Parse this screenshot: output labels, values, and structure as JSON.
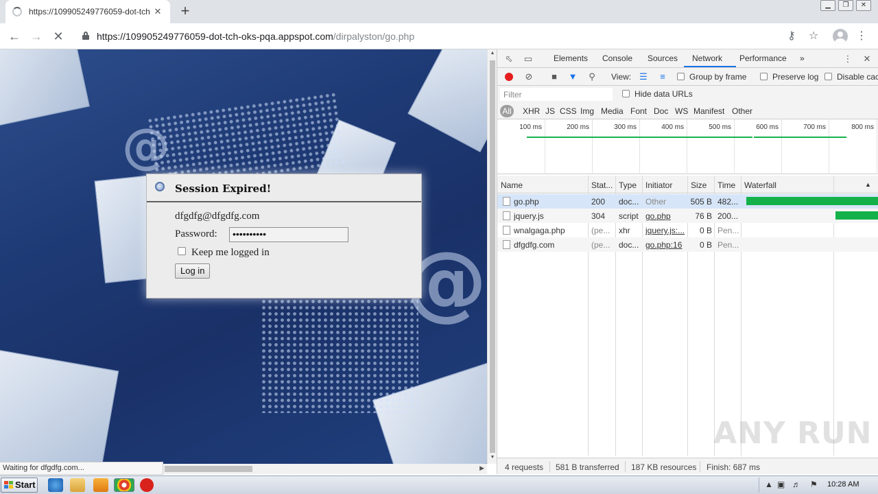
{
  "browser": {
    "tab_title": "https://109905249776059-dot-tch-oks",
    "tab_close": "✕",
    "new_tab": "+",
    "url_host": "https://109905249776059-dot-tch-oks-pqa.appspot.com",
    "url_path": "/dirpalyston/go.php",
    "window_buttons": [
      "▁",
      "❐",
      "✕"
    ]
  },
  "page": {
    "dialog_title": "Session Expired!",
    "email": "dfgdfg@dfgdfg.com",
    "password_label": "Password:",
    "password_value": "••••••••••",
    "keep_logged_in": "Keep me logged in",
    "login_button": "Log in",
    "status_bubble": "Waiting for dfgdfg.com..."
  },
  "devtools": {
    "tabs": [
      "Elements",
      "Console",
      "Sources",
      "Network",
      "Performance",
      "»"
    ],
    "active_tab": "Network",
    "view_label": "View:",
    "group_by_frame": "Group by frame",
    "preserve_log": "Preserve log",
    "disable_cache": "Disable cac",
    "filter_placeholder": "Filter",
    "hide_data_urls": "Hide data URLs",
    "type_filters": [
      "All",
      "XHR",
      "JS",
      "CSS",
      "Img",
      "Media",
      "Font",
      "Doc",
      "WS",
      "Manifest",
      "Other"
    ],
    "timeline_ticks": [
      "100 ms",
      "200 ms",
      "300 ms",
      "400 ms",
      "500 ms",
      "600 ms",
      "700 ms",
      "800 ms"
    ],
    "columns": [
      "Name",
      "Stat...",
      "Type",
      "Initiator",
      "Size",
      "Time",
      "Waterfall"
    ],
    "sort_indicator": "▲",
    "requests": [
      {
        "name": "go.php",
        "status": "200",
        "type": "doc...",
        "initiator": "Other",
        "size": "505 B",
        "time": "482...",
        "waterfall_start_ms": 10,
        "waterfall_end_ms": 490
      },
      {
        "name": "jquery.js",
        "status": "304",
        "type": "script",
        "initiator": "go.php",
        "size": "76 B",
        "time": "200...",
        "waterfall_start_ms": 490,
        "waterfall_end_ms": 690
      },
      {
        "name": "wnalgaga.php",
        "status": "(pe...",
        "type": "xhr",
        "initiator": "jquery.js:...",
        "size": "0 B",
        "time": "Pen..."
      },
      {
        "name": "dfgdfg.com",
        "status": "(pe...",
        "type": "doc...",
        "initiator": "go.php:16",
        "size": "0 B",
        "time": "Pen..."
      }
    ],
    "summary": {
      "requests": "4 requests",
      "transferred": "581 B transferred",
      "resources": "187 KB resources",
      "finish": "Finish: 687 ms"
    }
  },
  "watermark": "ANY RUN",
  "taskbar": {
    "start_label": "Start",
    "clock": "10:28 AM"
  },
  "colors": {
    "record": "#e51d1d",
    "waterfall": "#14b14a",
    "devtools_accent": "#1a73e8",
    "selected_row": "#d6e5f8"
  }
}
